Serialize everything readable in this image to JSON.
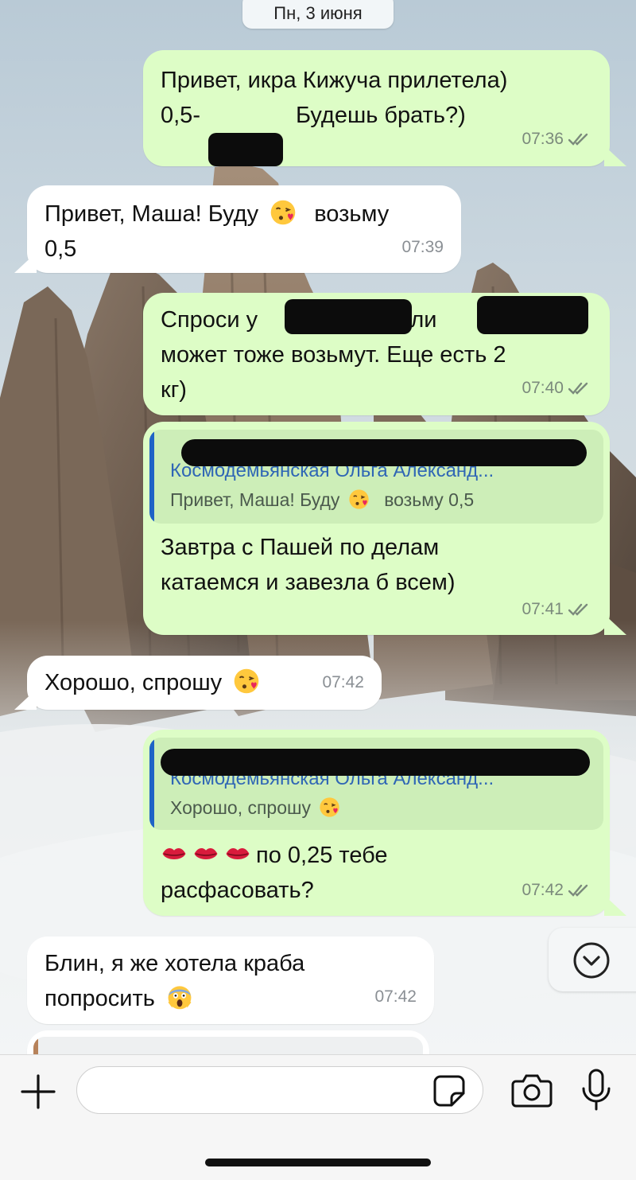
{
  "date_label": "Пн, 3 июня",
  "colors": {
    "outgoing_bubble": "#ddfdc6",
    "incoming_bubble": "#ffffff",
    "reply_bar": "#1e63c6",
    "read_ticks": "#7b8a7c"
  },
  "messages": [
    {
      "dir": "out",
      "line1": "Привет, икра Кижуча прилетела)",
      "line2a": "0,5-",
      "line2b": "Будешь брать?)",
      "time": "07:36",
      "status": "read"
    },
    {
      "dir": "in",
      "line1a": "Привет, Маша! Буду",
      "line1b": "возьму",
      "line2": "0,5",
      "time": "07:39"
    },
    {
      "dir": "out",
      "line1a": "Спроси у",
      "line1b": "или",
      "line2": "может тоже возьмут. Еще есть 2",
      "line3": "кг)",
      "time": "07:40",
      "status": "read"
    },
    {
      "dir": "out",
      "reply_name": "Космодемьянская Ольга Александ...",
      "reply_text_a": "Привет, Маша! Буду",
      "reply_text_b": "возьму 0,5",
      "line1": "Завтра с Пашей по делам",
      "line2": "катаемся и завезла б всем)",
      "time": "07:41",
      "status": "read"
    },
    {
      "dir": "in",
      "line1": "Хорошо, спрошу",
      "time": "07:42"
    },
    {
      "dir": "out",
      "reply_name": "Космодемьянская Ольга Александ...",
      "reply_text": "Хорошо, спрошу",
      "line1": "по 0,25 тебе",
      "line2": "расфасовать?",
      "time": "07:42",
      "status": "read"
    },
    {
      "dir": "in",
      "line1": "Блин, я же хотела краба",
      "line2": "попросить",
      "time": "07:42"
    }
  ],
  "icons": {
    "kiss": "face-blowing-kiss-icon",
    "lips": "kiss-mark-icon",
    "scream": "face-screaming-icon",
    "ticks": "double-check-icon",
    "scroll": "chevron-down-icon",
    "plus": "plus-icon",
    "sticker": "sticker-icon",
    "camera": "camera-icon",
    "mic": "microphone-icon"
  },
  "input": {
    "placeholder": ""
  }
}
